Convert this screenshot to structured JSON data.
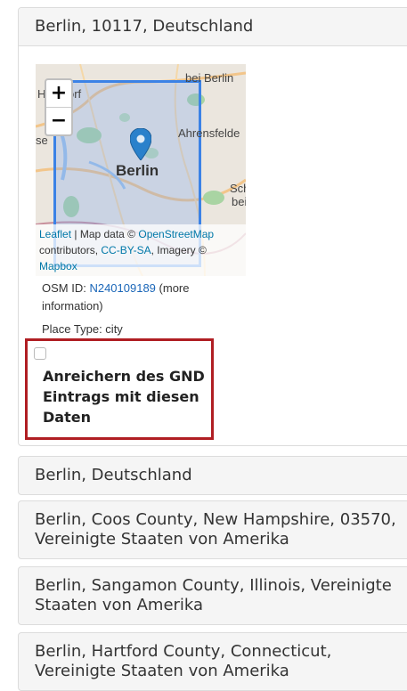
{
  "panels": [
    {
      "title": "Berlin, 10117, Deutschland"
    },
    {
      "title": "Berlin, Deutschland"
    },
    {
      "title": "Berlin, Coos County, New Hampshire, 03570, Vereinigte Staaten von Amerika"
    },
    {
      "title": "Berlin, Sangamon County, Illinois, Vereinigte Staaten von Amerika"
    },
    {
      "title": "Berlin, Hartford County, Connecticut, Vereinigte Staaten von Amerika"
    }
  ],
  "map": {
    "zoom_in": "+",
    "zoom_out": "−",
    "labels": {
      "berlin": "Berlin",
      "bei_berlin": "bei Berlin",
      "ahrensfelde": "Ahrensfelde",
      "hennigsdorf": "He  sdorf",
      "sch": "Sch",
      "bei": "bei",
      "se": "se"
    },
    "attribution": {
      "leaflet": "Leaflet",
      "map_data": " | Map data © ",
      "osm": "OpenStreetMap",
      "contributors": " contributors, ",
      "ccbysa": "CC-BY-SA",
      "imagery": ", Imagery © ",
      "mapbox": "Mapbox"
    }
  },
  "details": {
    "osm_id_label": "OSM ID: ",
    "osm_id": "N240109189",
    "more_info": " (more information)",
    "place_type": "Place Type: city"
  },
  "enrich": {
    "label": "Anreichern des GND Eintrags mit diesen Daten",
    "checked": false
  },
  "colors": {
    "bbox": "#3b82e6",
    "highlight_border": "#b01e23",
    "link": "#1a66b8"
  }
}
